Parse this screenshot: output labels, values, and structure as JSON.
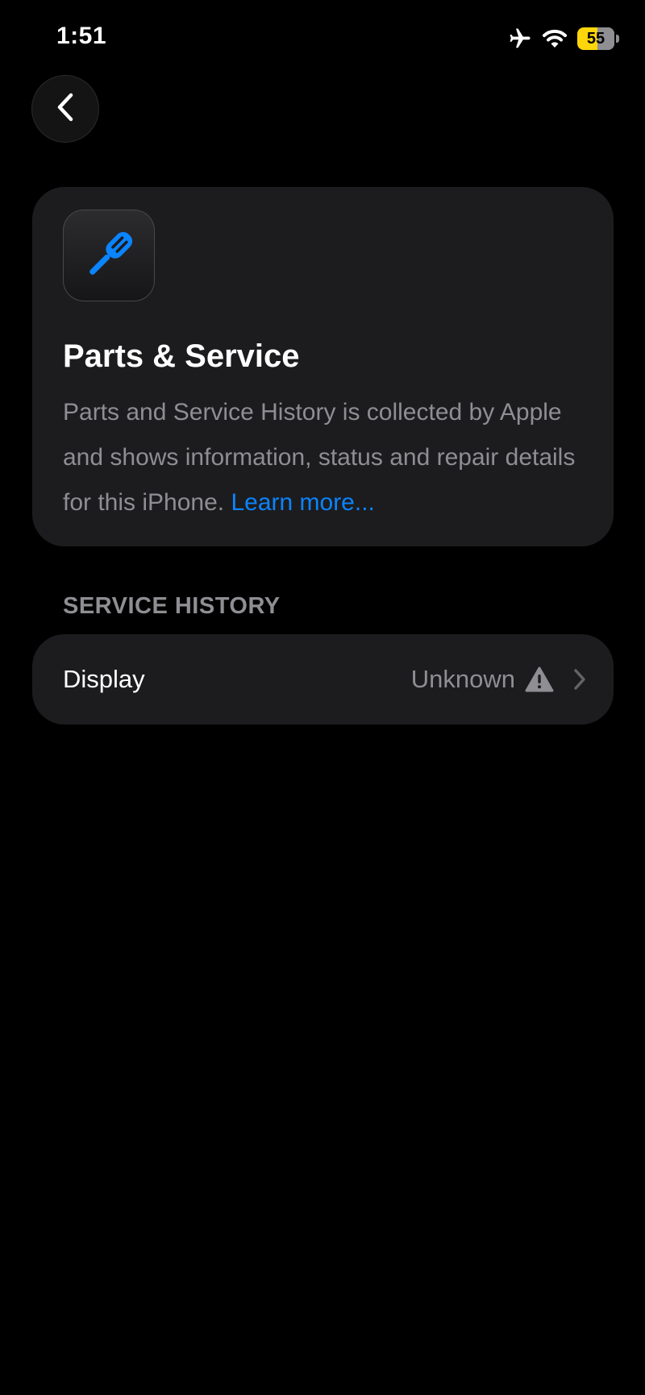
{
  "status_bar": {
    "time": "1:51",
    "battery_level": "55",
    "battery_fraction": 0.55,
    "icons": [
      "airplane-icon",
      "wifi-icon",
      "battery-icon"
    ],
    "battery_color": "#ffd60a"
  },
  "navigation": {
    "back_icon": "chevron-left-icon"
  },
  "info_card": {
    "icon": "screwdriver-icon",
    "icon_color": "#0a84ff",
    "title": "Parts & Service",
    "description": "Parts and Service History is collected by Apple and shows information, status and repair details for this iPhone. ",
    "link_label": "Learn more..."
  },
  "service_history": {
    "header": "SERVICE HISTORY",
    "items": [
      {
        "label": "Display",
        "value": "Unknown",
        "status_icon": "warning-icon",
        "trailing_icon": "chevron-right-icon"
      }
    ]
  }
}
